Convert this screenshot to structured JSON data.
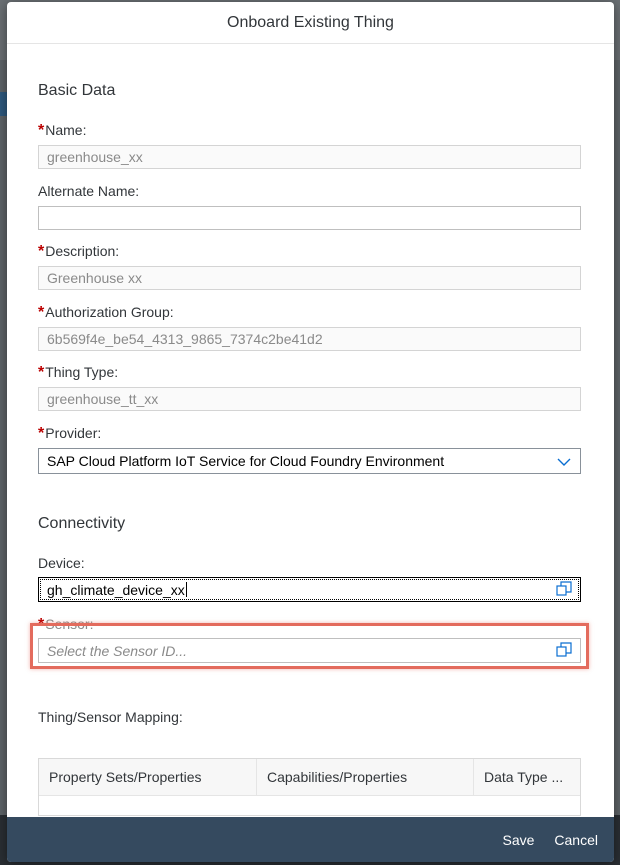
{
  "dialog": {
    "title": "Onboard Existing Thing"
  },
  "basic_data": {
    "title": "Basic Data",
    "name": {
      "label": "Name:",
      "value": "greenhouse_xx",
      "required": true
    },
    "alternate_name": {
      "label": "Alternate Name:",
      "value": ""
    },
    "description": {
      "label": "Description:",
      "value": "Greenhouse xx",
      "required": true
    },
    "authorization_group": {
      "label": "Authorization Group:",
      "value": "6b569f4e_be54_4313_9865_7374c2be41d2",
      "required": true
    },
    "thing_type": {
      "label": "Thing Type:",
      "value": "greenhouse_tt_xx",
      "required": true
    },
    "provider": {
      "label": "Provider:",
      "value": "SAP Cloud Platform IoT Service for Cloud Foundry Environment",
      "required": true
    }
  },
  "connectivity": {
    "title": "Connectivity",
    "device": {
      "label": "Device:",
      "value": "gh_climate_device_xx"
    },
    "sensor": {
      "label": "Sensor:",
      "placeholder": "Select the Sensor ID...",
      "required": true
    }
  },
  "mapping": {
    "title": "Thing/Sensor Mapping:",
    "columns": [
      "Property Sets/Properties",
      "Capabilities/Properties",
      "Data Type ..."
    ]
  },
  "footer": {
    "save": "Save",
    "cancel": "Cancel"
  },
  "colors": {
    "footer_bg": "#354a5f",
    "required": "#bb0000",
    "highlight": "#e36b5d"
  },
  "icons": {
    "value_help": "value-help-icon",
    "dropdown": "chevron-down-icon"
  }
}
